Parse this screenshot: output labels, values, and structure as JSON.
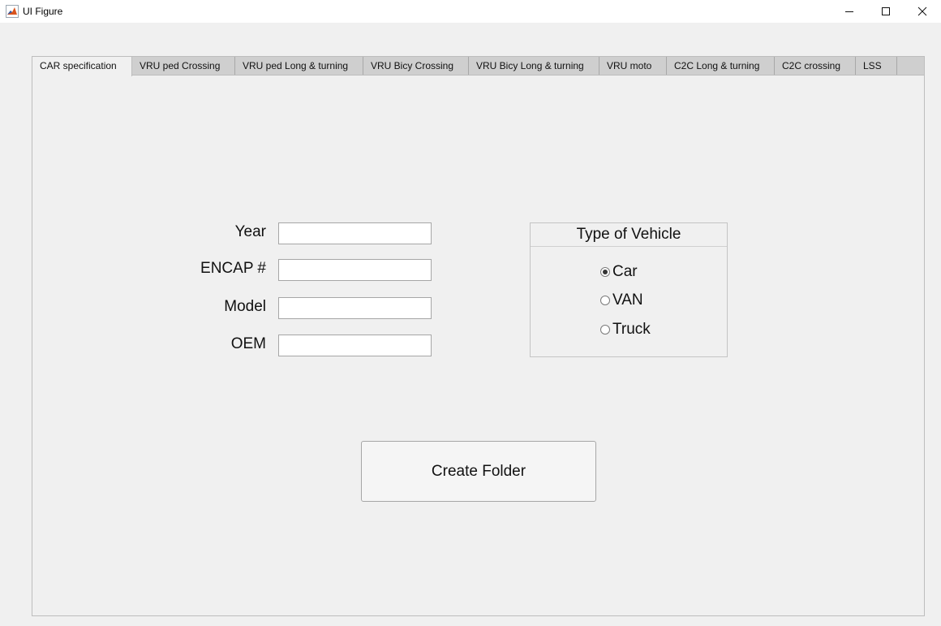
{
  "window": {
    "title": "UI Figure",
    "icon": "matlab-icon",
    "controls": [
      "minimize-icon",
      "maximize-icon",
      "close-icon"
    ]
  },
  "tabs": [
    {
      "label": "CAR specification",
      "active": true
    },
    {
      "label": "VRU ped Crossing",
      "active": false
    },
    {
      "label": "VRU ped Long & turning",
      "active": false
    },
    {
      "label": "VRU Bicy Crossing",
      "active": false
    },
    {
      "label": "VRU Bicy Long & turning",
      "active": false
    },
    {
      "label": "VRU moto",
      "active": false
    },
    {
      "label": "C2C Long & turning",
      "active": false
    },
    {
      "label": "C2C crossing",
      "active": false
    },
    {
      "label": "LSS",
      "active": false
    }
  ],
  "form": {
    "year_label": "Year",
    "year_value": "",
    "encap_label": "ENCAP #",
    "encap_value": "",
    "model_label": "Model",
    "model_value": "",
    "oem_label": "OEM",
    "oem_value": ""
  },
  "vehicle_type": {
    "title": "Type of Vehicle",
    "options": [
      {
        "label": "Car",
        "selected": true
      },
      {
        "label": "VAN",
        "selected": false
      },
      {
        "label": "Truck",
        "selected": false
      }
    ]
  },
  "create_button": {
    "label": "Create Folder"
  }
}
